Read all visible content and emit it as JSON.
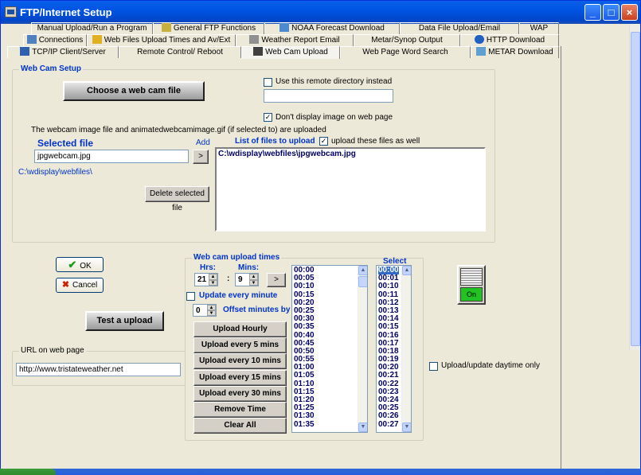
{
  "window": {
    "title": "FTP/Internet Setup",
    "min": "_",
    "max": "□",
    "close": "×"
  },
  "tabs": {
    "row1": [
      "Manual Upload/Run a Program",
      "General FTP Functions",
      "NOAA Forecast Download",
      "Data File Upload/Email",
      "WAP"
    ],
    "row2": [
      "Connections",
      "Web Files Upload Times and  Av/Ext",
      "Weather Report Email",
      "Metar/Synop Output",
      "HTTP Download"
    ],
    "row3": [
      "TCP/IP Client/Server",
      "Remote Control/ Reboot",
      "Web Cam Upload",
      "Web Page Word Search",
      "METAR Download"
    ]
  },
  "webcam": {
    "group_title": "Web Cam Setup",
    "choose_button": "Choose a web cam file",
    "remote_dir_label": "Use this remote directory instead",
    "remote_dir_value": "",
    "dont_display_label": "Don't display image on web page",
    "info_text": "The webcam image file and animatedwebcamimage.gif (if selected to) are uploaded",
    "selected_file_label": "Selected file",
    "add_label": "Add",
    "selected_file_value": "jpgwebcam.jpg",
    "add_arrow": ">",
    "path_text": "C:\\wdisplay\\webfiles\\",
    "delete_button": "Delete selected file",
    "list_title": "List of files to upload",
    "upload_these_label": "upload these files as well",
    "files": [
      "C:\\wdisplay\\webfiles\\jpgwebcam.jpg"
    ]
  },
  "buttons": {
    "ok": "OK",
    "cancel": "Cancel",
    "test": "Test a upload"
  },
  "url": {
    "group_title": "URL on web page",
    "value": "http://www.tristateweather.net"
  },
  "upload_times": {
    "group_title": "Web cam upload times",
    "hrs_label": "Hrs:",
    "mins_label": "Mins:",
    "hrs_value": "21",
    "colon": ":",
    "mins_value": "9",
    "add_arrow": ">",
    "update_minute_label": "Update every minute",
    "offset_value": "0",
    "offset_label": "Offset minutes by",
    "buttons": [
      "Upload Hourly",
      "Upload every 5 mins",
      "Upload every 10 mins",
      "Upload every 15 mins",
      "Upload every 30 mins",
      "Remove Time",
      "Clear All"
    ],
    "times": [
      "00:00",
      "00:05",
      "00:10",
      "00:15",
      "00:20",
      "00:25",
      "00:30",
      "00:35",
      "00:40",
      "00:45",
      "00:50",
      "00:55",
      "01:00",
      "01:05",
      "01:10",
      "01:15",
      "01:20",
      "01:25",
      "01:30",
      "01:35"
    ],
    "select_label": "Select",
    "select_items": [
      "00:00",
      "00:01",
      "00:10",
      "00:11",
      "00:12",
      "00:13",
      "00:14",
      "00:15",
      "00:16",
      "00:17",
      "00:18",
      "00:19",
      "00:20",
      "00:21",
      "00:22",
      "00:23",
      "00:24",
      "00:25",
      "00:26",
      "00:27"
    ]
  },
  "toggle": {
    "state": "On",
    "color": "#23c223"
  },
  "daytime_label": "Upload/update daytime only",
  "checks": {
    "checked": "✓",
    "tick_ok": "✔",
    "cross": "✖"
  }
}
